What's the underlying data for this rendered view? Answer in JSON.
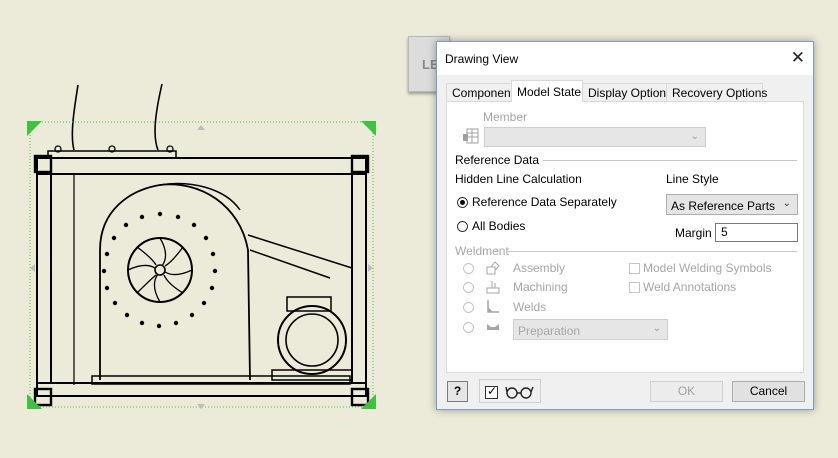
{
  "background_tab": {
    "label": "LE"
  },
  "dialog": {
    "title": "Drawing View",
    "tabs": [
      "Component",
      "Model State",
      "Display Options",
      "Recovery Options"
    ],
    "active_tab": "Model State",
    "member": {
      "label": "Member",
      "value": ""
    },
    "reference_data": {
      "section_label": "Reference Data",
      "hidden_line_label": "Hidden Line Calculation",
      "option_separately": "Reference Data Separately",
      "option_all_bodies": "All Bodies",
      "line_style_label": "Line Style",
      "line_style_value": "As Reference Parts",
      "margin_label": "Margin",
      "margin_value": "5"
    },
    "weldment": {
      "section_label": "Weldment",
      "options": [
        "Assembly",
        "Machining",
        "Welds"
      ],
      "preparation_value": "Preparation",
      "model_welding_symbols": "Model Welding Symbols",
      "weld_annotations": "Weld Annotations"
    },
    "buttons": {
      "ok": "OK",
      "cancel": "Cancel",
      "help": "?"
    }
  },
  "colors": {
    "selection": "#3cc43c",
    "canvas": "#ecebd9",
    "dialog_border": "#7a9ccf"
  }
}
